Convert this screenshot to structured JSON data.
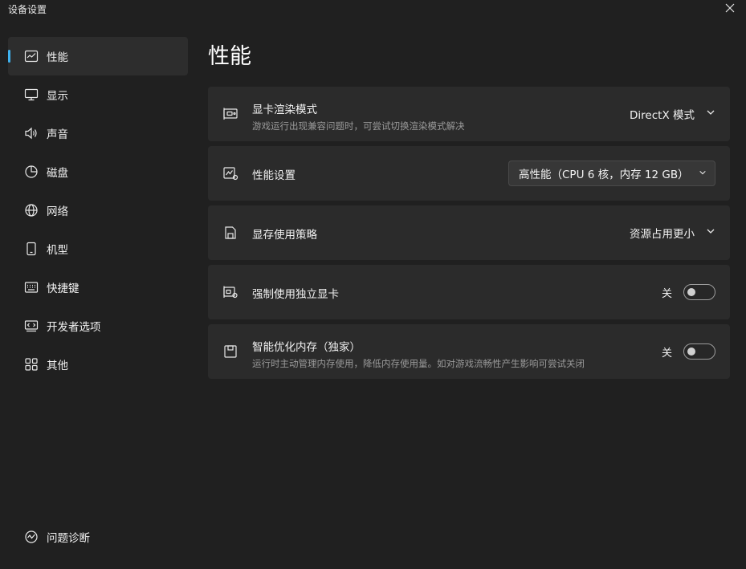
{
  "window": {
    "title": "设备设置",
    "close_icon": "close-icon"
  },
  "sidebar": {
    "items": [
      {
        "label": "性能",
        "icon": "chart-line-icon",
        "active": true
      },
      {
        "label": "显示",
        "icon": "monitor-icon",
        "active": false
      },
      {
        "label": "声音",
        "icon": "speaker-icon",
        "active": false
      },
      {
        "label": "磁盘",
        "icon": "pie-chart-icon",
        "active": false
      },
      {
        "label": "网络",
        "icon": "globe-icon",
        "active": false
      },
      {
        "label": "机型",
        "icon": "phone-icon",
        "active": false
      },
      {
        "label": "快捷键",
        "icon": "keyboard-icon",
        "active": false
      },
      {
        "label": "开发者选项",
        "icon": "developer-icon",
        "active": false
      },
      {
        "label": "其他",
        "icon": "grid-icon",
        "active": false
      }
    ],
    "bottom": {
      "label": "问题诊断",
      "icon": "diagnose-icon"
    }
  },
  "main": {
    "title": "性能",
    "settings": [
      {
        "title": "显卡渲染模式",
        "description": "游戏运行出现兼容问题时，可尝试切换渲染模式解决",
        "control": "dropdown",
        "value": "DirectX 模式",
        "icon": "gpu-card-icon"
      },
      {
        "title": "性能设置",
        "description": "",
        "control": "combo",
        "value": "高性能（CPU 6 核，内存 12 GB）",
        "icon": "performance-icon"
      },
      {
        "title": "显存使用策略",
        "description": "",
        "control": "dropdown",
        "value": "资源占用更小",
        "icon": "save-disk-icon"
      },
      {
        "title": "强制使用独立显卡",
        "description": "",
        "control": "toggle",
        "value": "关",
        "state": false,
        "icon": "gpu-settings-icon"
      },
      {
        "title": "智能优化内存（独家）",
        "description": "运行时主动管理内存使用，降低内存使用量。如对游戏流畅性产生影响可尝试关闭",
        "control": "toggle",
        "value": "关",
        "state": false,
        "icon": "memory-icon"
      }
    ]
  },
  "colors": {
    "accent": "#3fb2ef",
    "background": "#202020",
    "card": "#2b2b2b"
  }
}
